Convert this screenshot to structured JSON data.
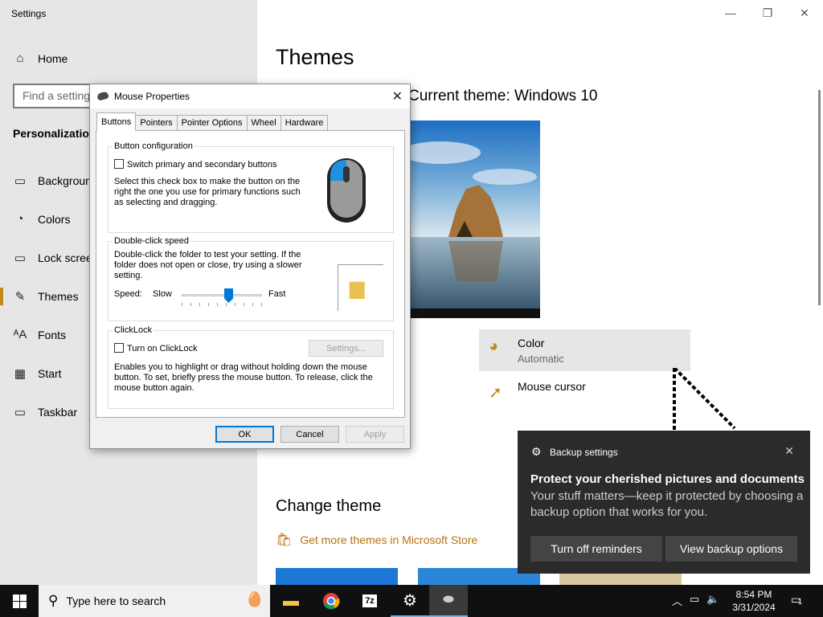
{
  "window": {
    "title": "Settings",
    "controls": {
      "minimize": "—",
      "maximize": "❐",
      "close": "✕"
    }
  },
  "sidebar": {
    "home": "Home",
    "search_placeholder": "Find a setting",
    "section": "Personalization",
    "items": [
      {
        "label": "Background",
        "icon": "image-icon"
      },
      {
        "label": "Colors",
        "icon": "palette-icon"
      },
      {
        "label": "Lock screen",
        "icon": "lock-screen-icon"
      },
      {
        "label": "Themes",
        "icon": "brush-icon"
      },
      {
        "label": "Fonts",
        "icon": "font-icon"
      },
      {
        "label": "Start",
        "icon": "start-icon"
      },
      {
        "label": "Taskbar",
        "icon": "taskbar-icon"
      }
    ],
    "active_item": "Themes",
    "accent_color": "#c38a1a"
  },
  "main": {
    "title": "Themes",
    "current_theme": "Current theme: Windows 10",
    "options": [
      {
        "label": "Color",
        "value": "Automatic",
        "icon": "palette-icon"
      },
      {
        "label": "Mouse cursor",
        "icon": "cursor-icon"
      }
    ],
    "change_theme": "Change theme",
    "store_link": "Get more themes in Microsoft Store"
  },
  "dialog": {
    "title": "Mouse Properties",
    "close": "✕",
    "tabs": [
      "Buttons",
      "Pointers",
      "Pointer Options",
      "Wheel",
      "Hardware"
    ],
    "selected_tab": "Buttons",
    "button_config": {
      "label": "Button configuration",
      "checkbox": "Switch primary and secondary buttons",
      "description": "Select this check box to make the button on the right the one you use for primary functions such as selecting and dragging."
    },
    "double_click": {
      "label": "Double-click speed",
      "description": "Double-click the folder to test your setting. If the folder does not open or close, try using a slower setting.",
      "speed_label": "Speed:",
      "slow": "Slow",
      "fast": "Fast",
      "speed_value": 0.58
    },
    "clicklock": {
      "label": "ClickLock",
      "checkbox": "Turn on ClickLock",
      "settings_button": "Settings...",
      "description": "Enables you to highlight or drag without holding down the mouse button. To set, briefly press the mouse button. To release, click the mouse button again."
    },
    "buttons": {
      "ok": "OK",
      "cancel": "Cancel",
      "apply": "Apply"
    }
  },
  "notification": {
    "app": "Backup settings",
    "close": "✕",
    "heading": "Protect your cherished pictures and documents",
    "body": "Your stuff matters—keep it protected by choosing a backup option that works for you.",
    "buttons": [
      "Turn off reminders",
      "View backup options"
    ]
  },
  "taskbar": {
    "search_placeholder": "Type here to search",
    "time": "8:54 PM",
    "date": "3/31/2024",
    "notification_count": "1",
    "apps": [
      "file-explorer-icon",
      "chrome-icon",
      "7zip-icon",
      "settings-icon",
      "mouse-properties-icon"
    ]
  }
}
